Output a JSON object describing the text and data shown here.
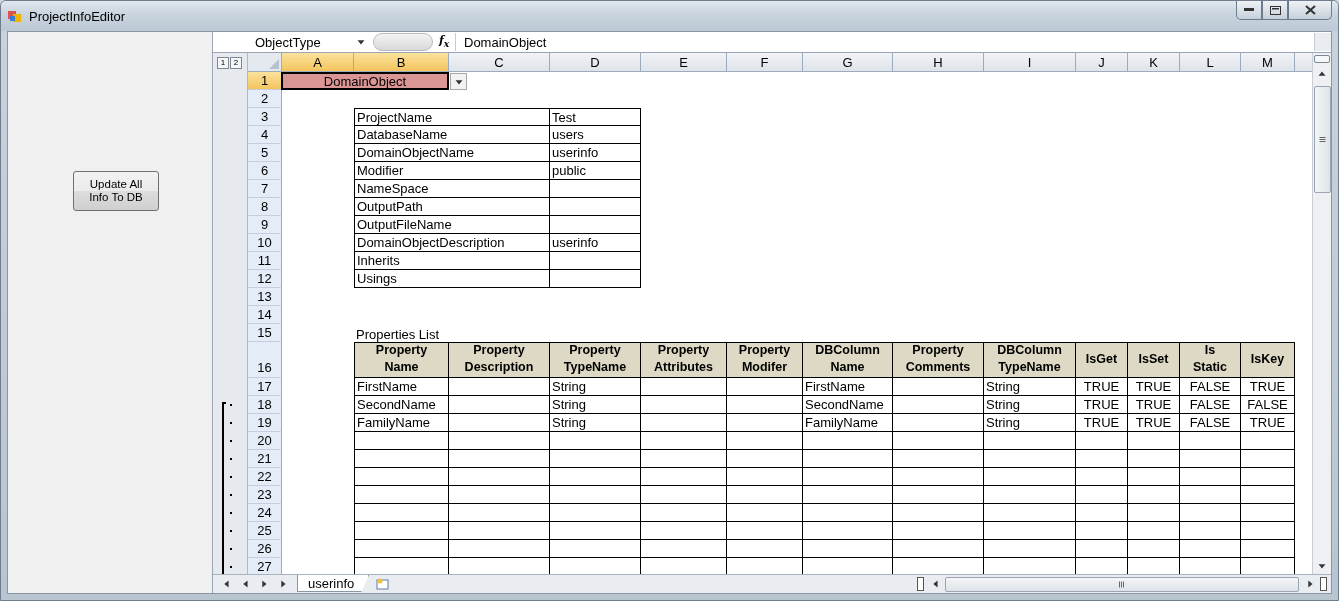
{
  "window": {
    "title": "ProjectInfoEditor"
  },
  "left_panel": {
    "button_lines": [
      "Update All",
      "Info To DB"
    ]
  },
  "formula_bar": {
    "name_box": "ObjectType",
    "function_label": "f$_{x}$",
    "content": "DomainObject"
  },
  "outline_levels": [
    "1",
    "2"
  ],
  "columns": [
    {
      "label": "A",
      "selected": true
    },
    {
      "label": "B",
      "selected": true
    },
    {
      "label": "C",
      "selected": false
    },
    {
      "label": "D",
      "selected": false
    },
    {
      "label": "E",
      "selected": false
    },
    {
      "label": "F",
      "selected": false
    },
    {
      "label": "G",
      "selected": false
    },
    {
      "label": "H",
      "selected": false
    },
    {
      "label": "I",
      "selected": false
    },
    {
      "label": "J",
      "selected": false
    },
    {
      "label": "K",
      "selected": false
    },
    {
      "label": "L",
      "selected": false
    },
    {
      "label": "M",
      "selected": false
    }
  ],
  "row_headers": [
    {
      "label": "1",
      "selected": true
    },
    {
      "label": "2",
      "selected": false
    },
    {
      "label": "3",
      "selected": false
    },
    {
      "label": "4",
      "selected": false
    },
    {
      "label": "5",
      "selected": false
    },
    {
      "label": "6",
      "selected": false
    },
    {
      "label": "7",
      "selected": false
    },
    {
      "label": "8",
      "selected": false
    },
    {
      "label": "9",
      "selected": false
    },
    {
      "label": "10",
      "selected": false
    },
    {
      "label": "11",
      "selected": false
    },
    {
      "label": "12",
      "selected": false
    },
    {
      "label": "13",
      "selected": false
    },
    {
      "label": "14",
      "selected": false
    },
    {
      "label": "15",
      "selected": false
    },
    {
      "label": "16",
      "selected": false
    },
    {
      "label": "17",
      "selected": false
    },
    {
      "label": "18",
      "selected": false
    },
    {
      "label": "19",
      "selected": false
    },
    {
      "label": "20",
      "selected": false
    },
    {
      "label": "21",
      "selected": false
    },
    {
      "label": "22",
      "selected": false
    },
    {
      "label": "23",
      "selected": false
    },
    {
      "label": "24",
      "selected": false
    },
    {
      "label": "25",
      "selected": false
    },
    {
      "label": "26",
      "selected": false
    },
    {
      "label": "27",
      "selected": false
    }
  ],
  "active_cell": {
    "value": "DomainObject"
  },
  "info_table": [
    {
      "label": "ProjectName",
      "value": "Test"
    },
    {
      "label": "DatabaseName",
      "value": "users"
    },
    {
      "label": "DomainObjectName",
      "value": "userinfo"
    },
    {
      "label": "Modifier",
      "value": "public"
    },
    {
      "label": "NameSpace"
    },
    {
      "label": "OutputPath"
    },
    {
      "label": "OutputFileName"
    },
    {
      "label": "DomainObjectDescription",
      "value": "userinfo"
    },
    {
      "label": "Inherits"
    },
    {
      "label": "Usings"
    }
  ],
  "properties": {
    "title": "Properties List",
    "columns": [
      {
        "label": "Property\nName",
        "kind": "text"
      },
      {
        "label": "Property\nDescription",
        "kind": "text"
      },
      {
        "label": "Property\nTypeName",
        "kind": "text"
      },
      {
        "label": "Property\nAttributes",
        "kind": "text"
      },
      {
        "label": "Property\nModifer",
        "kind": "text"
      },
      {
        "label": "DBColumn\nName",
        "kind": "text"
      },
      {
        "label": "Property\nComments",
        "kind": "text"
      },
      {
        "label": "DBColumn\nTypeName",
        "kind": "text"
      },
      {
        "label": "IsGet",
        "kind": "bool"
      },
      {
        "label": "IsSet",
        "kind": "bool"
      },
      {
        "label": "Is\nStatic",
        "kind": "bool"
      },
      {
        "label": "IsKey",
        "kind": "bool"
      }
    ],
    "rows": [
      [
        "FirstName",
        "",
        "String",
        "",
        "",
        "FirstName",
        "",
        "String",
        "TRUE",
        "TRUE",
        "FALSE",
        "TRUE"
      ],
      [
        "SecondName",
        "",
        "String",
        "",
        "",
        "SecondName",
        "",
        "String",
        "TRUE",
        "TRUE",
        "FALSE",
        "FALSE"
      ],
      [
        "FamilyName",
        "",
        "String",
        "",
        "",
        "FamilyName",
        "",
        "String",
        "TRUE",
        "TRUE",
        "FALSE",
        "TRUE"
      ]
    ]
  },
  "sheet_tabs": [
    {
      "label": "userinfo",
      "selected": true
    }
  ]
}
